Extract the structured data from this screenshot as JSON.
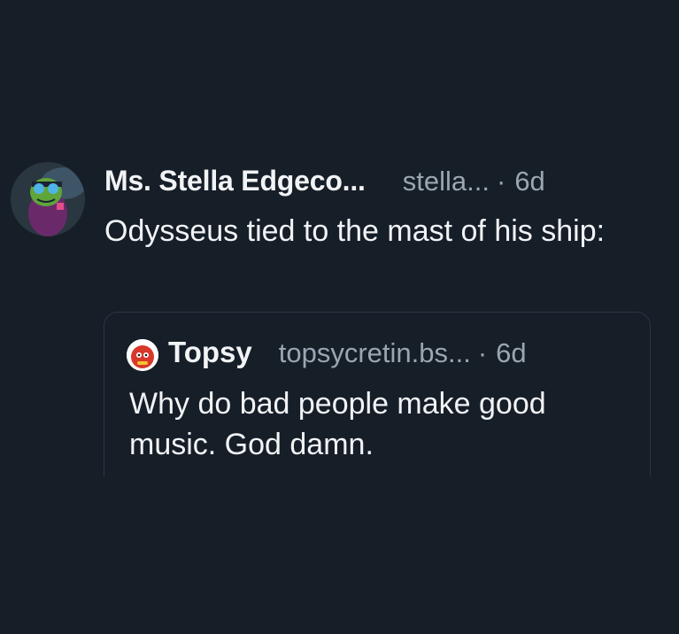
{
  "post": {
    "author": {
      "display_name": "Ms. Stella Edgeco...",
      "handle": "stella...",
      "avatar_icon": "character-avatar-icon"
    },
    "separator": "·",
    "time_ago": "6d",
    "text": "Odysseus tied to the mast of his ship:"
  },
  "quote": {
    "author": {
      "display_name": "Topsy",
      "handle": "topsycretin.bs...",
      "avatar_icon": "red-character-avatar-icon"
    },
    "separator": "·",
    "time_ago": "6d",
    "text": "Why do bad people make good music. God damn."
  },
  "colors": {
    "background": "#161e28",
    "primary_text": "#f1f3f5",
    "secondary_text": "#9aa6b2",
    "card_border": "#2b3542"
  }
}
